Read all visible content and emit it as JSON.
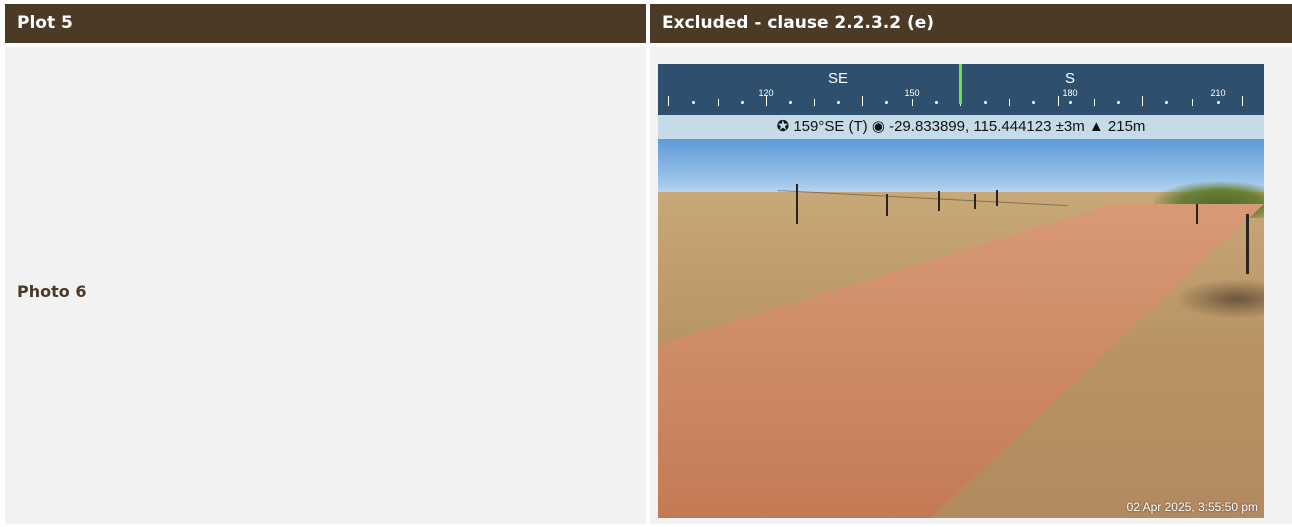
{
  "table": {
    "header_left": "Plot 5",
    "header_right": "Excluded - clause 2.2.3.2 (e)",
    "row_label": "Photo 6"
  },
  "photo": {
    "compass": {
      "directions": [
        "SE",
        "S"
      ],
      "degree_labels": [
        "120",
        "150",
        "180",
        "210"
      ]
    },
    "info_bar": "✪ 159°SE (T) ◉ -29.833899, 115.444123 ±3m ▲ 215m",
    "timestamp": "02 Apr 2025, 3:55:50 pm"
  },
  "colors": {
    "header_bg": "#4a3a26",
    "cell_bg": "#f2f2f2",
    "compass_bg": "#2e4f6e",
    "needle": "#6ee04b"
  }
}
